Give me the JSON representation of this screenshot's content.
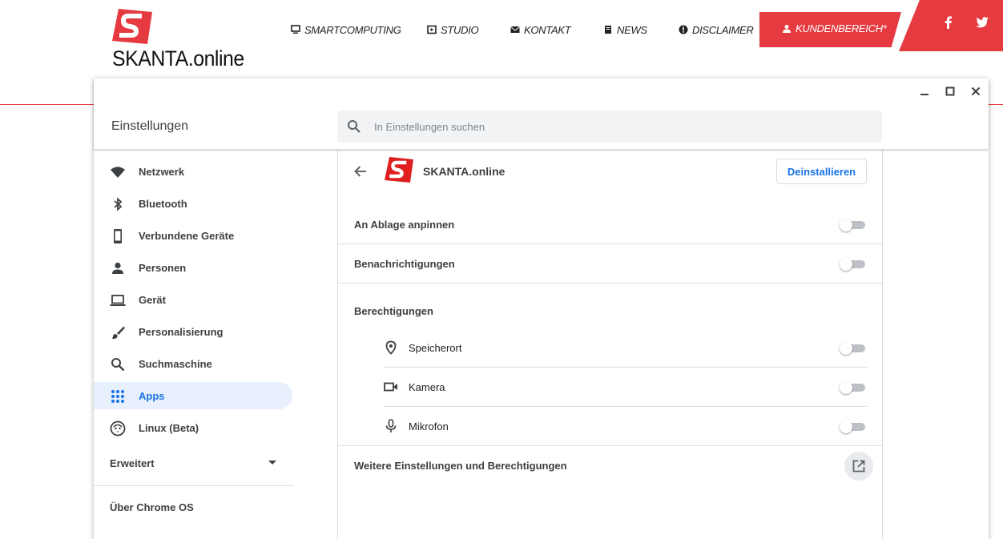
{
  "site": {
    "brand": "SKANTA.online",
    "nav": [
      {
        "label": "SMARTCOMPUTING",
        "icon": "monitor-icon"
      },
      {
        "label": "STUDIO",
        "icon": "film-icon"
      },
      {
        "label": "KONTAKT",
        "icon": "mail-icon"
      },
      {
        "label": "NEWS",
        "icon": "book-icon"
      },
      {
        "label": "DISCLAIMER",
        "icon": "info-icon"
      }
    ],
    "customer_area": {
      "label": "KUNDENBEREICH*",
      "icon": "user-icon"
    },
    "social": [
      {
        "icon": "facebook-icon"
      },
      {
        "icon": "twitter-icon"
      }
    ],
    "accent_color": "#e53a40"
  },
  "window": {
    "controls": [
      "minimize-icon",
      "maximize-icon",
      "close-icon"
    ]
  },
  "settings": {
    "title": "Einstellungen",
    "search_placeholder": "In Einstellungen suchen",
    "sidebar": {
      "items": [
        {
          "label": "Netzwerk",
          "icon": "wifi-icon",
          "active": false
        },
        {
          "label": "Bluetooth",
          "icon": "bluetooth-icon",
          "active": false
        },
        {
          "label": "Verbundene Geräte",
          "icon": "phone-icon",
          "active": false
        },
        {
          "label": "Personen",
          "icon": "person-icon",
          "active": false
        },
        {
          "label": "Gerät",
          "icon": "laptop-icon",
          "active": false
        },
        {
          "label": "Personalisierung",
          "icon": "brush-icon",
          "active": false
        },
        {
          "label": "Suchmaschine",
          "icon": "search-icon",
          "active": false
        },
        {
          "label": "Apps",
          "icon": "apps-grid-icon",
          "active": true
        },
        {
          "label": "Linux (Beta)",
          "icon": "linux-penguin-icon",
          "active": false
        }
      ],
      "advanced": "Erweitert",
      "about": "Über Chrome OS"
    },
    "app_detail": {
      "name": "SKANTA.online",
      "uninstall_label": "Deinstallieren",
      "rows": [
        {
          "label": "An Ablage anpinnen",
          "enabled": false
        },
        {
          "label": "Benachrichtigungen",
          "enabled": false
        }
      ],
      "permissions_heading": "Berechtigungen",
      "permissions": [
        {
          "label": "Speicherort",
          "icon": "location-pin-icon",
          "enabled": false
        },
        {
          "label": "Kamera",
          "icon": "videocam-icon",
          "enabled": false
        },
        {
          "label": "Mikrofon",
          "icon": "microphone-icon",
          "enabled": false
        }
      ],
      "more_settings": "Weitere Einstellungen und Berechtigungen"
    },
    "accent_color": "#1a73e8"
  }
}
